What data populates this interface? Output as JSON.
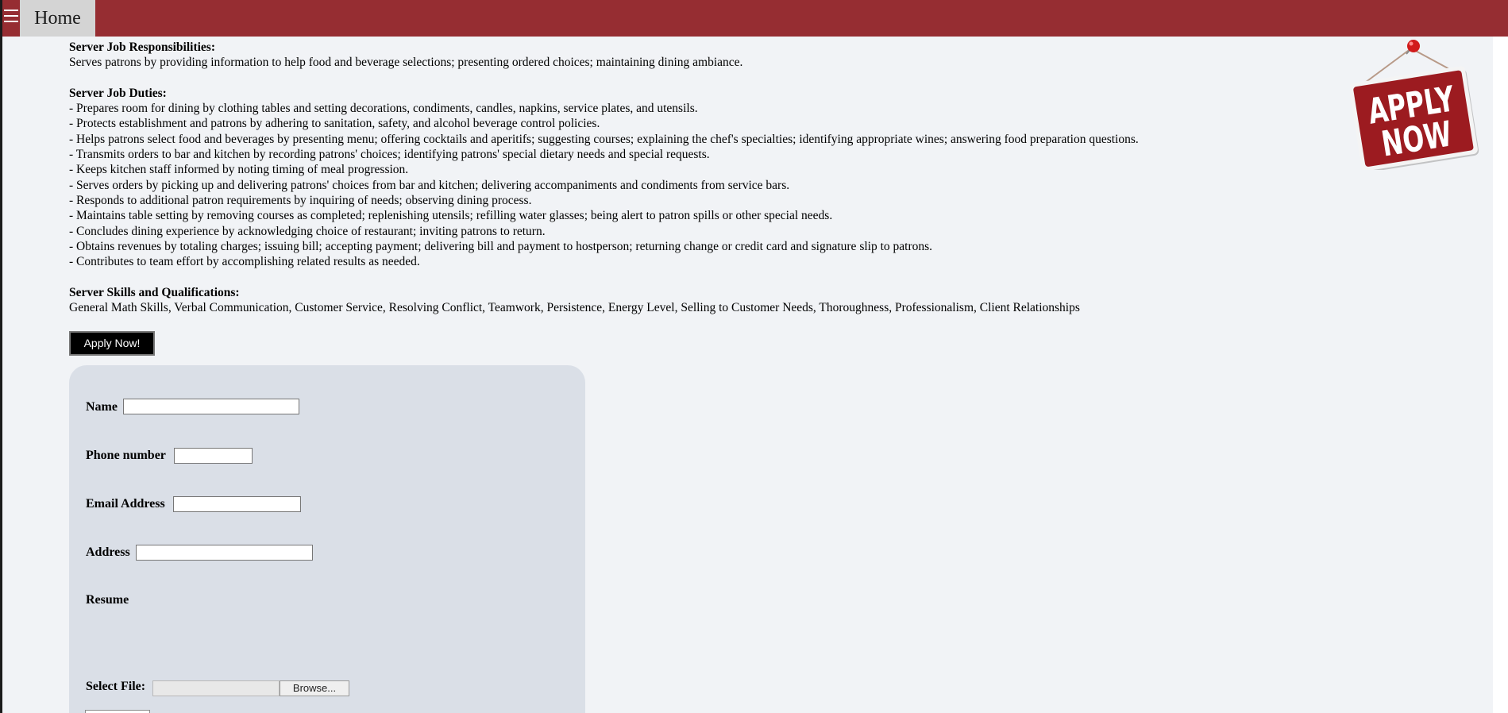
{
  "header": {
    "home_label": "Home"
  },
  "job": {
    "responsibilities_heading": "Server Job Responsibilities:",
    "responsibilities_text": "Serves patrons by providing information to help food and beverage selections; presenting ordered choices; maintaining dining ambiance.",
    "duties_heading": "Server Job Duties:",
    "duties": [
      "- Prepares room for dining by clothing tables and setting decorations, condiments, candles, napkins, service plates, and utensils.",
      "- Protects establishment and patrons by adhering to sanitation, safety, and alcohol beverage control policies.",
      "- Helps patrons select food and beverages by presenting menu; offering cocktails and aperitifs; suggesting courses; explaining the chef's specialties; identifying appropriate wines; answering food preparation questions.",
      "- Transmits orders to bar and kitchen by recording patrons' choices; identifying patrons' special dietary needs and special requests.",
      "- Keeps kitchen staff informed by noting timing of meal progression.",
      "- Serves orders by picking up and delivering patrons' choices from bar and kitchen; delivering accompaniments and condiments from service bars.",
      "- Responds to additional patron requirements by inquiring of needs; observing dining process.",
      "- Maintains table setting by removing courses as completed; replenishing utensils; refilling water glasses; being alert to patron spills or other special needs.",
      "- Concludes dining experience by acknowledging choice of restaurant; inviting patrons to return.",
      "- Obtains revenues by totaling charges; issuing bill; accepting payment; delivering bill and payment to hostperson; returning change or credit card and signature slip to patrons.",
      "- Contributes to team effort by accomplishing related results as needed."
    ],
    "skills_heading": "Server Skills and Qualifications:",
    "skills_text": "General Math Skills, Verbal Communication, Customer Service, Resolving Conflict, Teamwork, Persistence, Energy Level, Selling to Customer Needs, Thoroughness, Professionalism, Client Relationships"
  },
  "apply_button_label": "Apply Now!",
  "sign": {
    "line1": "APPLY",
    "line2": "NOW"
  },
  "form": {
    "name_label": "Name",
    "name_value": "",
    "phone_label": "Phone number",
    "phone_value": "",
    "email_label": "Email Address",
    "email_value": "",
    "address_label": "Address",
    "address_value": "",
    "resume_label": "Resume",
    "select_file_label": "Select File:",
    "browse_label": "Browse..."
  },
  "colors": {
    "header_bar": "#962d32",
    "page_background": "#f1f3f6",
    "form_panel": "#dadfe7",
    "sign_red": "#9c1b20"
  },
  "icons": {
    "menu": "hamburger-menu-icon",
    "pin": "push-pin-icon"
  }
}
